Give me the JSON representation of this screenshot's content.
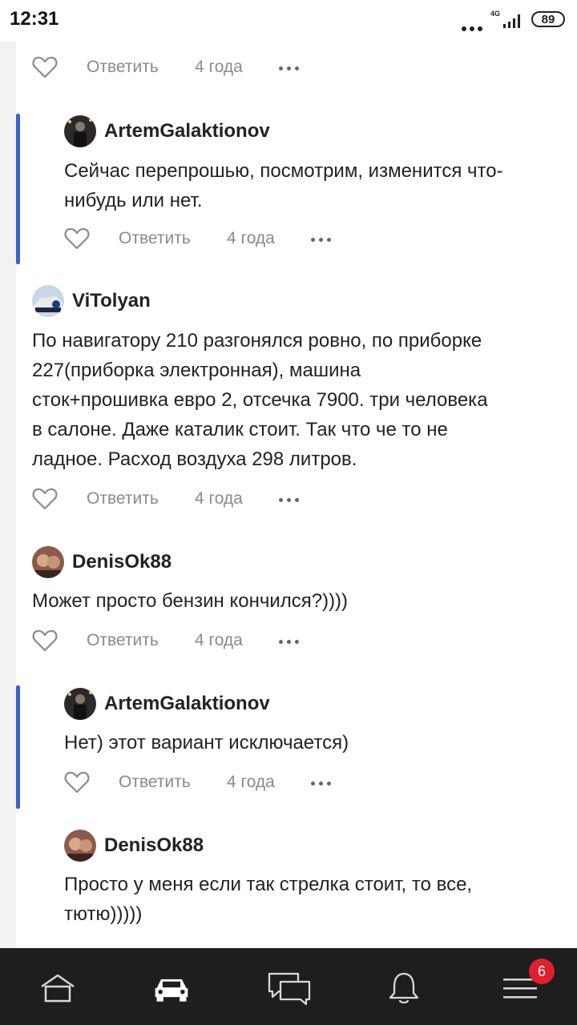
{
  "status_bar": {
    "time": "12:31",
    "network": "4G",
    "battery": "89"
  },
  "actions_labels": {
    "reply": "Ответить",
    "age": "4 года"
  },
  "comments": [
    {
      "username": "ArtemGalaktionov",
      "text": "Сейчас перепрошью, посмотрим, изменится что-\nнибудь или нет.",
      "reply": "Ответить",
      "age": "4 года"
    },
    {
      "username": "ViTolyan",
      "text": "По навигатору 210 разгонялся ровно, по приборке\n227(приборка электронная), машина\nсток+прошивка евро 2, отсечка 7900. три человека\nв салоне. Даже каталик стоит. Так что че то не\nладное. Расход воздуха 298 литров.",
      "reply": "Ответить",
      "age": "4 года"
    },
    {
      "username": "DenisOk88",
      "text": "Может просто бензин кончился?))))",
      "reply": "Ответить",
      "age": "4 года"
    },
    {
      "username": "ArtemGalaktionov",
      "text": "Нет) этот вариант исключается)",
      "reply": "Ответить",
      "age": "4 года"
    },
    {
      "username": "DenisOk88",
      "text": "Просто у меня если так стрелка стоит, то все,\nтютю)))))"
    }
  ],
  "top_actions": {
    "reply": "Ответить",
    "age": "4 года"
  },
  "bottom_nav": {
    "items": [
      "home-icon",
      "car-icon",
      "messages-icon",
      "bell-icon",
      "menu-icon"
    ],
    "menu_badge": "6"
  },
  "colors": {
    "accent": "#3d63c9",
    "badge": "#e0202e",
    "nav_bg": "#1e1e1e"
  }
}
